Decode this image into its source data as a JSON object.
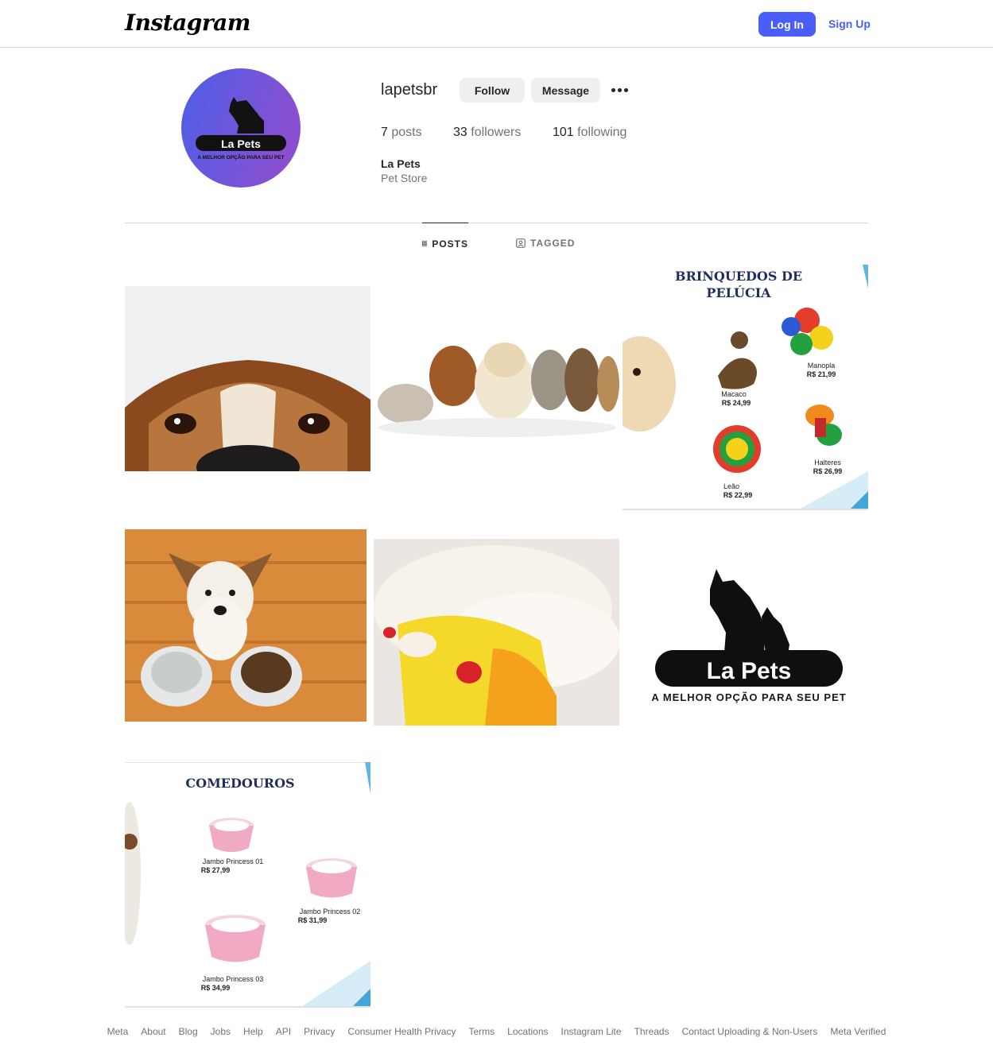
{
  "header": {
    "logo_text": "Instagram",
    "login_label": "Log In",
    "signup_label": "Sign Up"
  },
  "profile": {
    "username": "lapetsbr",
    "follow_label": "Follow",
    "message_label": "Message",
    "more_icon": "more-horizontal-icon",
    "stats": {
      "posts_count": "7",
      "posts_label": "posts",
      "followers_count": "33",
      "followers_label": "followers",
      "following_count": "101",
      "following_label": "following"
    },
    "full_name": "La Pets",
    "category": "Pet Store",
    "avatar": {
      "brand": "La Pets",
      "tagline": "A MELHOR OPÇÃO PARA SEU PET"
    }
  },
  "tabs": [
    {
      "label": "POSTS",
      "icon": "grid-icon",
      "active": true
    },
    {
      "label": "TAGGED",
      "icon": "tagged-icon",
      "active": false
    }
  ],
  "posts": {
    "plush_toys": {
      "title_line1": "BRINQUEDOS DE",
      "title_line2": "PELÚCIA",
      "items": [
        {
          "name": "Manopla",
          "price": "R$ 21,99"
        },
        {
          "name": "Macaco",
          "price": "R$ 24,99"
        },
        {
          "name": "Halteres",
          "price": "R$ 26,99"
        },
        {
          "name": "Leão",
          "price": "R$ 22,99"
        }
      ]
    },
    "logo_post": {
      "brand": "La Pets",
      "tagline": "A MELHOR OPÇÃO PARA SEU PET"
    },
    "feeders": {
      "title": "COMEDOUROS",
      "items": [
        {
          "name": "Jambo Princess 01",
          "price": "R$ 27,99"
        },
        {
          "name": "Jambo Princess 02",
          "price": "R$ 31,99"
        },
        {
          "name": "Jambo Princess 03",
          "price": "R$ 34,99"
        }
      ]
    }
  },
  "footer": {
    "links": [
      "Meta",
      "About",
      "Blog",
      "Jobs",
      "Help",
      "API",
      "Privacy",
      "Consumer Health Privacy",
      "Terms",
      "Locations",
      "Instagram Lite",
      "Threads",
      "Contact Uploading & Non-Users",
      "Meta Verified"
    ]
  },
  "colors": {
    "accent": "#4a5df9",
    "avatar_gradient_start": "#4c5ee8",
    "avatar_gradient_end": "#8a4fd0"
  }
}
